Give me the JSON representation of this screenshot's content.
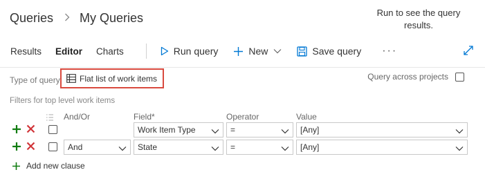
{
  "breadcrumb": {
    "root": "Queries",
    "current": "My Queries"
  },
  "hint": {
    "text": "Run to see the query results."
  },
  "toolbar": {
    "tabs": [
      {
        "label": "Results",
        "active": false
      },
      {
        "label": "Editor",
        "active": true
      },
      {
        "label": "Charts",
        "active": false
      }
    ],
    "run_query": "Run query",
    "new": "New",
    "save_query": "Save query",
    "more": "···"
  },
  "query_type": {
    "label": "Type of query",
    "value": "Flat list of work items",
    "across_projects_label": "Query across projects",
    "across_projects_checked": false
  },
  "filters": {
    "title": "Filters for top level work items",
    "headers": {
      "andor": "And/Or",
      "field": "Field*",
      "operator": "Operator",
      "value": "Value"
    },
    "rows": [
      {
        "andor": "",
        "field": "Work Item Type",
        "operator": "=",
        "value": "[Any]"
      },
      {
        "andor": "And",
        "field": "State",
        "operator": "=",
        "value": "[Any]"
      }
    ],
    "add_clause": "Add new clause"
  },
  "colors": {
    "accent": "#0078d4",
    "add_green": "#107c10",
    "delete_red": "#d13438",
    "highlight_border": "#d9493e"
  }
}
